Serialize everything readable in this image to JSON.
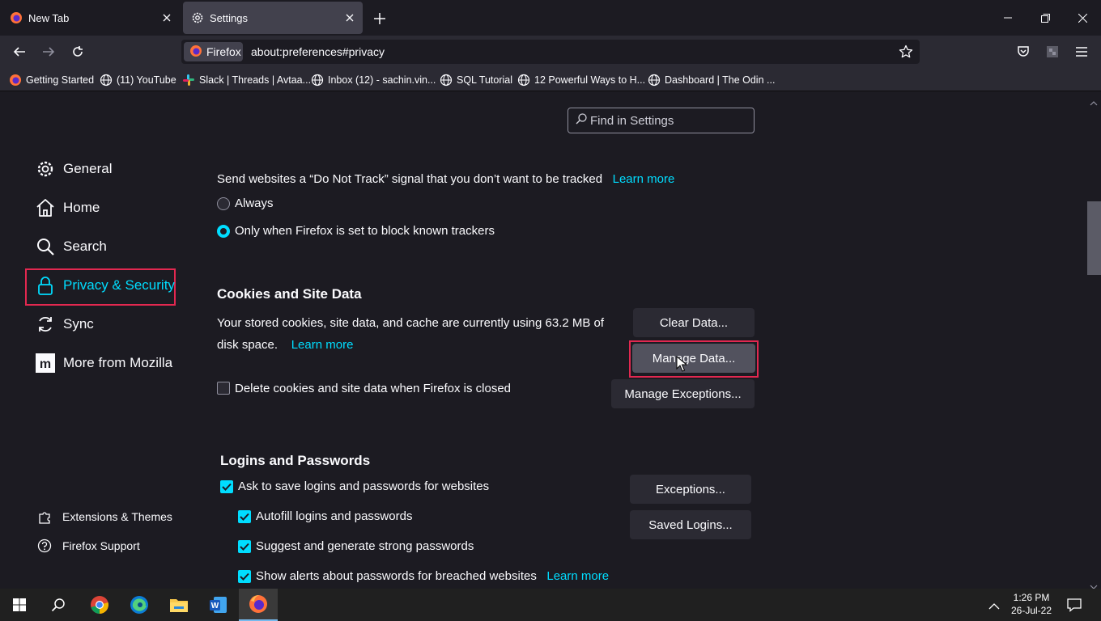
{
  "tabs": [
    {
      "label": "New Tab",
      "icon": "firefox-icon"
    },
    {
      "label": "Settings",
      "icon": "gear-icon"
    }
  ],
  "navbar": {
    "identity_label": "Firefox",
    "url": "about:preferences#privacy"
  },
  "bookmarks": [
    {
      "label": "Getting Started",
      "icon": "firefox-icon"
    },
    {
      "label": "(11) YouTube",
      "icon": "globe-icon"
    },
    {
      "label": "Slack | Threads | Avtaa...",
      "icon": "slack-icon"
    },
    {
      "label": "Inbox (12) - sachin.vin...",
      "icon": "globe-icon"
    },
    {
      "label": "SQL Tutorial",
      "icon": "globe-icon"
    },
    {
      "label": "12 Powerful Ways to H...",
      "icon": "globe-icon"
    },
    {
      "label": "Dashboard | The Odin ...",
      "icon": "globe-icon"
    }
  ],
  "search": {
    "placeholder": "Find in Settings"
  },
  "sidebar": {
    "items": [
      {
        "label": "General",
        "icon": "gear-icon"
      },
      {
        "label": "Home",
        "icon": "home-icon"
      },
      {
        "label": "Search",
        "icon": "search-icon"
      },
      {
        "label": "Privacy & Security",
        "icon": "lock-icon",
        "selected": true
      },
      {
        "label": "Sync",
        "icon": "sync-icon"
      },
      {
        "label": "More from Mozilla",
        "icon": "mozilla-icon"
      }
    ],
    "footer": [
      {
        "label": "Extensions & Themes",
        "icon": "puzzle-icon"
      },
      {
        "label": "Firefox Support",
        "icon": "help-icon"
      }
    ]
  },
  "dnt": {
    "text": "Send websites a “Do Not Track” signal that you don’t want to be tracked",
    "learn_more": "Learn more",
    "options": [
      {
        "label": "Always",
        "selected": false
      },
      {
        "label": "Only when Firefox is set to block known trackers",
        "selected": true
      }
    ]
  },
  "cookies": {
    "heading": "Cookies and Site Data",
    "desc_line1": "Your stored cookies, site data, and cache are currently using 63.2 MB of",
    "desc_line2": "disk space.",
    "learn_more": "Learn more",
    "delete_label": "Delete cookies and site data when Firefox is closed",
    "delete_checked": false,
    "clear_button": "Clear Data...",
    "manage_button": "Manage Data...",
    "exceptions_button": "Manage Exceptions..."
  },
  "logins": {
    "heading": "Logins and Passwords",
    "ask_label": "Ask to save logins and passwords for websites",
    "autofill_label": "Autofill logins and passwords",
    "suggest_label": "Suggest and generate strong passwords",
    "alerts_label": "Show alerts about passwords for breached websites",
    "learn_more": "Learn more",
    "exceptions_button": "Exceptions...",
    "saved_logins_button": "Saved Logins..."
  },
  "taskbar": {
    "apps": [
      "windows-start-icon",
      "search-icon",
      "chrome-icon",
      "edge-icon",
      "file-explorer-icon",
      "word-icon",
      "firefox-icon"
    ],
    "time": "1:26 PM",
    "date": "26-Jul-22"
  },
  "colors": {
    "accent": "#00ddff",
    "highlight": "#e22850",
    "background": "#1c1b22",
    "button": "#2b2a33"
  }
}
